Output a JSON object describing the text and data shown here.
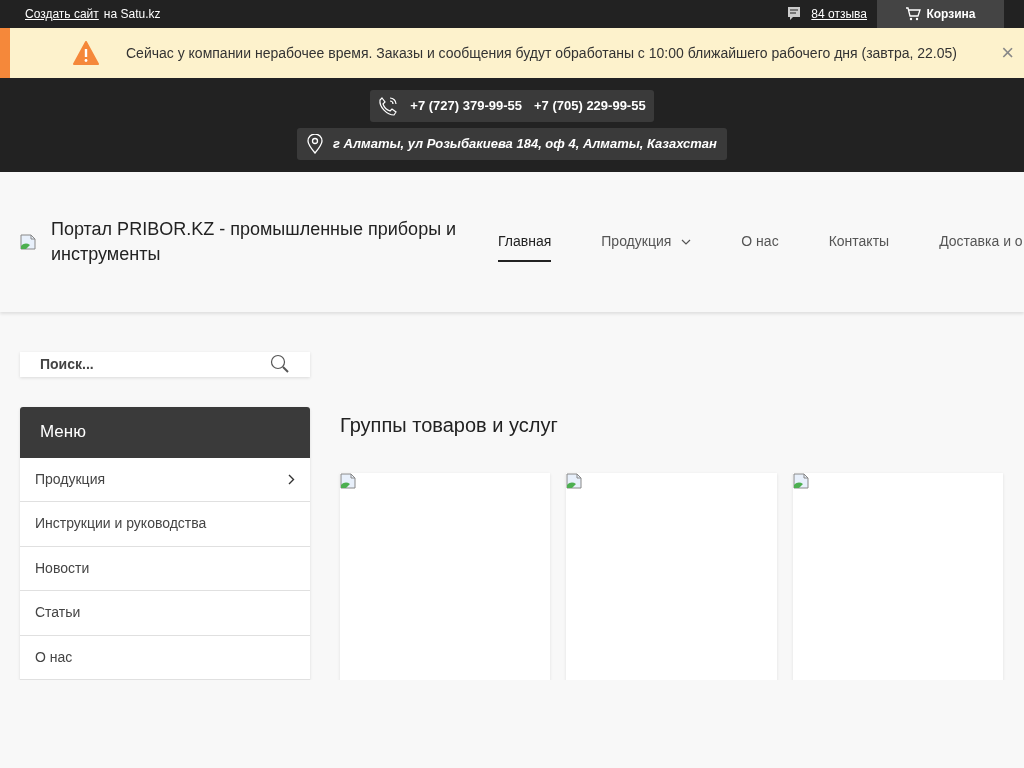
{
  "top_bar": {
    "create_link": "Создать сайт",
    "create_suffix": "на Satu.kz",
    "reviews_link": "84 отзыва",
    "cart_button": "Корзина"
  },
  "notice": {
    "text": "Сейчас у компании нерабочее время. Заказы и сообщения будут обработаны с 10:00 ближайшего рабочего дня (завтра, 22.05)",
    "close": "×"
  },
  "contacts": {
    "phones": [
      "+7 (727) 379-99-55",
      "+7 (705) 229-99-55"
    ],
    "address": "г Алматы, ул Розыбакиева 184, оф 4, Алматы, Казахстан"
  },
  "header": {
    "site_title": "Портал PRIBOR.KZ - промышленные приборы и инструменты",
    "nav": [
      {
        "label": "Главная",
        "selected": true,
        "dropdown": false
      },
      {
        "label": "Продукция",
        "selected": false,
        "dropdown": true
      },
      {
        "label": "О нас",
        "selected": false,
        "dropdown": false
      },
      {
        "label": "Контакты",
        "selected": false,
        "dropdown": false
      },
      {
        "label": "Доставка и о",
        "selected": false,
        "dropdown": false
      }
    ]
  },
  "search": {
    "placeholder": "Поиск..."
  },
  "menu": {
    "title": "Меню",
    "items": [
      {
        "label": "Продукция",
        "submenu": true
      },
      {
        "label": "Инструкции и руководства",
        "submenu": false
      },
      {
        "label": "Новости",
        "submenu": false
      },
      {
        "label": "Статьи",
        "submenu": false
      },
      {
        "label": "О нас",
        "submenu": false
      }
    ]
  },
  "main": {
    "heading": "Группы товаров и услуг"
  }
}
